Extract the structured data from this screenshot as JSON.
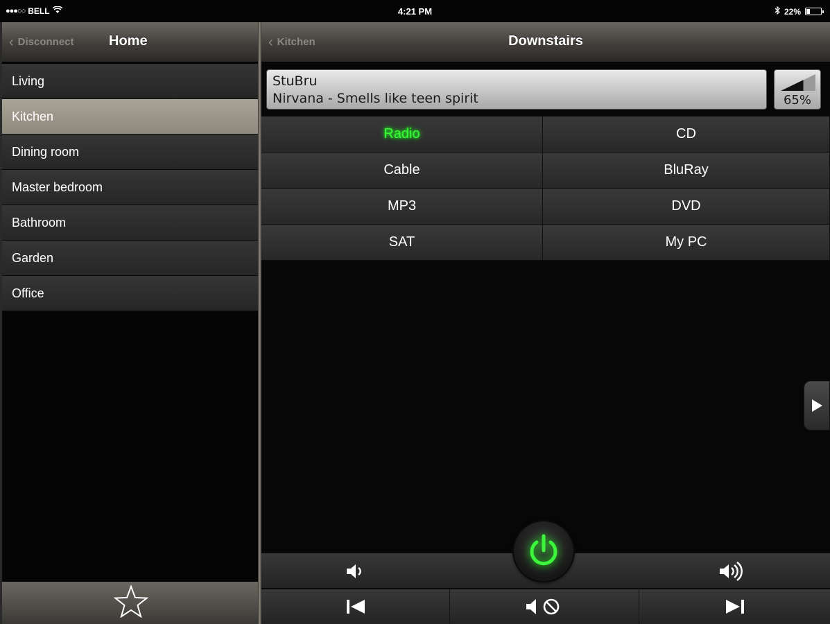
{
  "status_bar": {
    "carrier": "BELL",
    "signal_dots": "●●●○○",
    "time": "4:21 PM",
    "battery": "22%",
    "battery_level": 0.22
  },
  "left": {
    "back_label": "Disconnect",
    "title": "Home",
    "rooms": [
      {
        "label": "Living",
        "selected": false
      },
      {
        "label": "Kitchen",
        "selected": true
      },
      {
        "label": "Dining room",
        "selected": false
      },
      {
        "label": "Master bedroom",
        "selected": false
      },
      {
        "label": "Bathroom",
        "selected": false
      },
      {
        "label": "Garden",
        "selected": false
      },
      {
        "label": "Office",
        "selected": false
      }
    ],
    "footer_icon": "star-icon"
  },
  "right": {
    "back_label": "Kitchen",
    "title": "Downstairs",
    "now_playing": {
      "station": "StuBru",
      "track": "Nirvana - Smells like teen spirit"
    },
    "volume": {
      "percent_label": "65%",
      "level": 0.65
    },
    "sources": [
      {
        "label": "Radio",
        "active": true
      },
      {
        "label": "CD",
        "active": false
      },
      {
        "label": "Cable",
        "active": false
      },
      {
        "label": "BluRay",
        "active": false
      },
      {
        "label": "MP3",
        "active": false
      },
      {
        "label": "DVD",
        "active": false
      },
      {
        "label": "SAT",
        "active": false
      },
      {
        "label": "My PC",
        "active": false
      }
    ]
  },
  "colors": {
    "accent_green": "#3df53d",
    "selected_room": "#9f988c",
    "navbar": "#4a4743"
  }
}
